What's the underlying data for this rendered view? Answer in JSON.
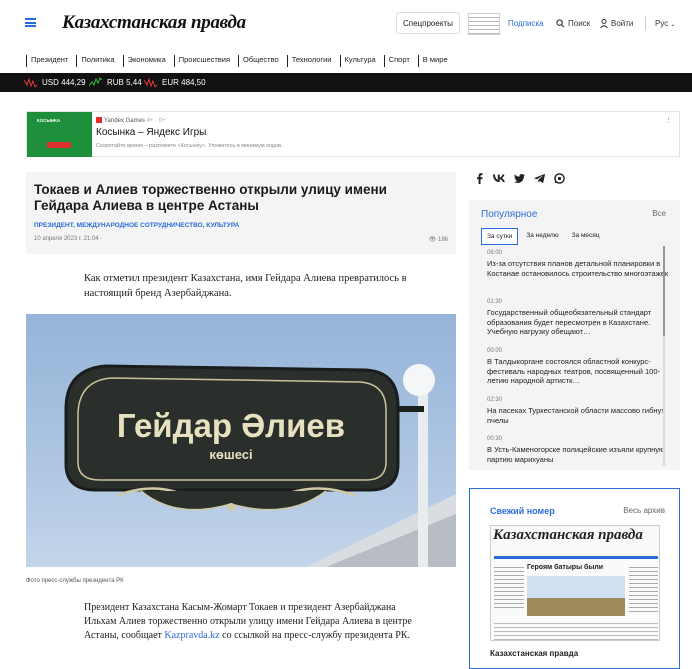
{
  "header": {
    "logo": "Казахстанская правда",
    "special": "Спецпроекты",
    "subscribe": "Подписка",
    "search": "Поиск",
    "login": "Войти",
    "lang": "Рус"
  },
  "nav": [
    "Президент",
    "Политика",
    "Экономика",
    "Происшествия",
    "Общество",
    "Технологии",
    "Культура",
    "Спорт",
    "В мире"
  ],
  "ticker": [
    {
      "label": "USD 444,29",
      "trend": "down",
      "color": "#e53935"
    },
    {
      "label": "RUB 5,44",
      "trend": "up",
      "color": "#2fbf4a"
    },
    {
      "label": "EUR 484,50",
      "trend": "down",
      "color": "#e53935"
    }
  ],
  "ad": {
    "source": "Yandex Games",
    "age": "4+ · 0+",
    "title": "Косынка – Яндекс Игры",
    "desc": "Скоротайте время – разложите «Косынку». Уложитесь в минимум ходов.",
    "image_text": "КОСЫНКА"
  },
  "article": {
    "title": "Токаев и Алиев торжественно открыли улицу имени Гейдара Алиева в центре Астаны",
    "tags": "ПРЕЗИДЕНТ, МЕЖДУНАРОДНОЕ СОТРУДНИЧЕСТВО, КУЛЬТУРА",
    "date": "10 апреля 2023 г. 21:04 ·",
    "views": "196",
    "lead": "Как отметил президент Казахстана, имя Гейдара Алиева превратилось в настоящий бренд Азербайджана.",
    "sign_main": "Гейдар Әлиев",
    "sign_sub": "көшесі",
    "caption": "Фото пресс-службы президента РК",
    "body_before": "Президент Казахстана Касым-Жомарт Токаев и президент Азербайджана Ильхам Алиев торжественно открыли улицу имени Гейдара Алиева в центре Астаны, сообщает ",
    "body_link": "Kazpravda.kz",
    "body_after": " со ссылкой на пресс-службу президента РК."
  },
  "popular": {
    "title": "Популярное",
    "all": "Все",
    "tabs": [
      "За сутки",
      "За неделю",
      "За месяц"
    ],
    "items": [
      {
        "time": "06:00",
        "text": "Из-за отсутствия планов детальной планировки в Костанае остановилось строительство многоэтажек"
      },
      {
        "time": "01:30",
        "text": "Государственный общеобязательный стандарт образования будет пересмотрен в Казахстане. Учебную нагрузку обещают…"
      },
      {
        "time": "00:00",
        "text": "В Талдыкоргане состоялся областной конкурс-фестиваль народных театров, посвященный 100-летию народной артистк…"
      },
      {
        "time": "02:30",
        "text": "На пасеках Туркестанской области массово гибнут пчелы"
      },
      {
        "time": "00:30",
        "text": "В Усть-Каменогорске полицейские изъяли крупную партию марихуаны"
      }
    ]
  },
  "fresh": {
    "title": "Свежий номер",
    "all": "Весь архив",
    "paper_title": "Казахстанская правда",
    "headline": "Героям батыры были",
    "caption": "Казахстанская правда"
  }
}
